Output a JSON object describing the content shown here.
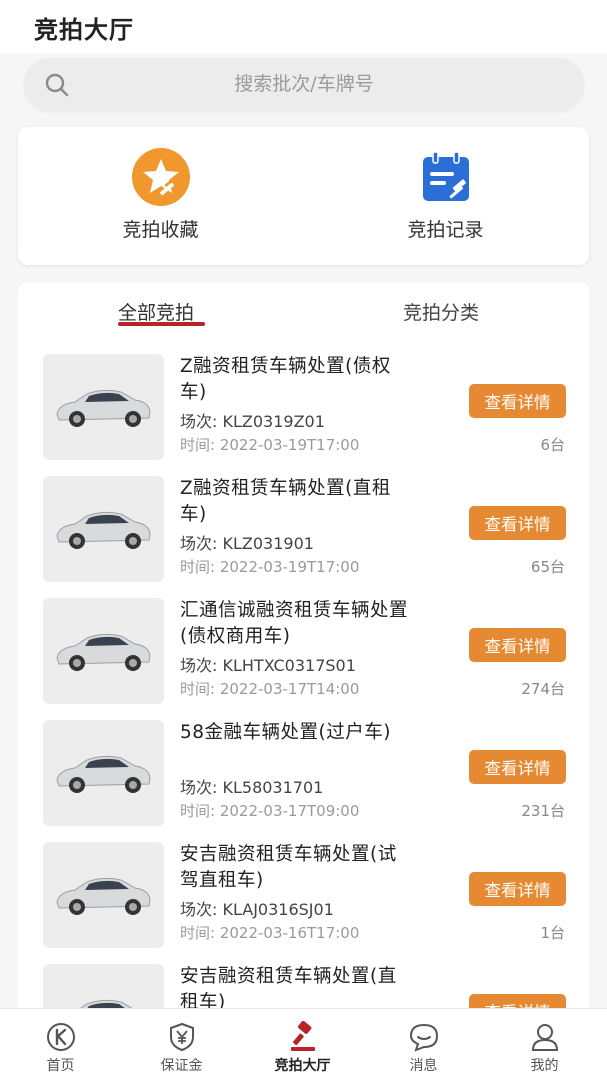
{
  "header": {
    "title": "竞拍大厅"
  },
  "search": {
    "placeholder": "搜索批次/车牌号"
  },
  "quick_actions": [
    {
      "label": "竞拍收藏",
      "icon": "star-auction-icon",
      "color": "#f0982e"
    },
    {
      "label": "竞拍记录",
      "icon": "calendar-record-icon",
      "color": "#2b6fd6"
    }
  ],
  "tabs": [
    {
      "label": "全部竞拍",
      "active": true
    },
    {
      "label": "竞拍分类",
      "active": false
    }
  ],
  "auctions": [
    {
      "title": "Z融资租赁车辆处置(债权车)",
      "code": "场次: KLZ0319Z01",
      "time": "时间: 2022-03-19T17:00",
      "count": "6台",
      "button": "查看详情"
    },
    {
      "title": "Z融资租赁车辆处置(直租车)",
      "code": "场次: KLZ031901",
      "time": "时间: 2022-03-19T17:00",
      "count": "65台",
      "button": "查看详情"
    },
    {
      "title": "汇通信诚融资租赁车辆处置(债权商用车)",
      "code": "场次: KLHTXC0317S01",
      "time": "时间: 2022-03-17T14:00",
      "count": "274台",
      "button": "查看详情"
    },
    {
      "title": "58金融车辆处置(过户车)",
      "code": "场次: KL58031701",
      "time": "时间: 2022-03-17T09:00",
      "count": "231台",
      "button": "查看详情"
    },
    {
      "title": "安吉融资租赁车辆处置(试驾直租车)",
      "code": "场次: KLAJ0316SJ01",
      "time": "时间: 2022-03-16T17:00",
      "count": "1台",
      "button": "查看详情"
    },
    {
      "title": "安吉融资租赁车辆处置(直租车)",
      "code": "",
      "time": "",
      "count": "",
      "button": "查看详情"
    }
  ],
  "bottom_nav": [
    {
      "label": "首页",
      "icon": "home-k-icon"
    },
    {
      "label": "保证金",
      "icon": "deposit-shield-icon"
    },
    {
      "label": "竞拍大厅",
      "icon": "gavel-icon",
      "active": true
    },
    {
      "label": "消息",
      "icon": "message-icon"
    },
    {
      "label": "我的",
      "icon": "user-icon"
    }
  ],
  "colors": {
    "accent_orange": "#e58a32",
    "tab_underline": "#b8232a",
    "active_nav": "#b8232a"
  }
}
